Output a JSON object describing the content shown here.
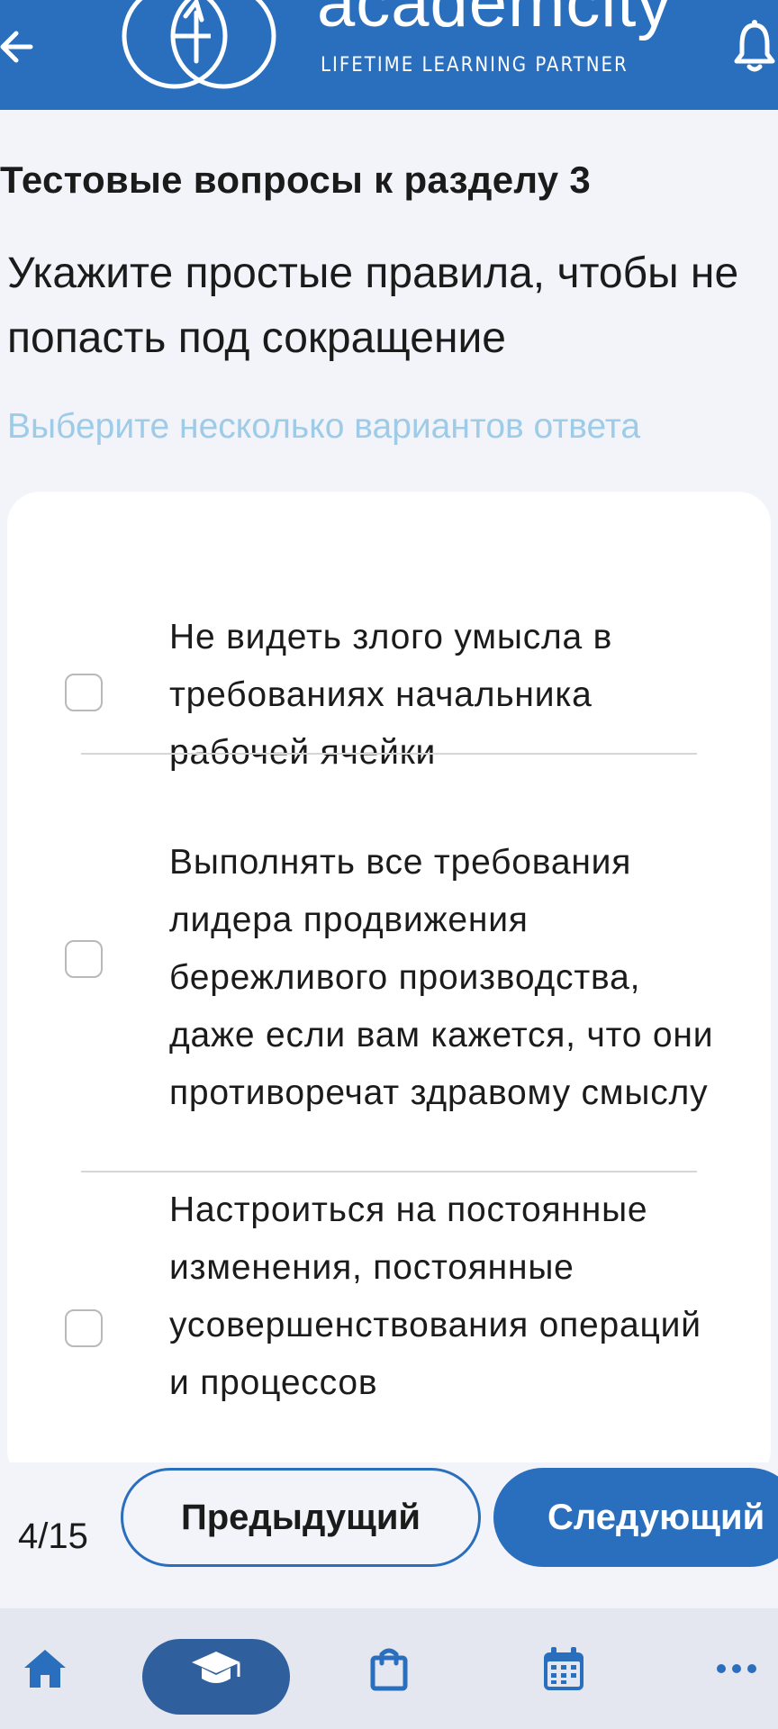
{
  "header": {
    "brand_name": "academcity",
    "brand_tagline": "LIFETIME LEARNING PARTNER",
    "colors": {
      "primary": "#2a6fbd",
      "text_on_primary": "#ffffff"
    }
  },
  "page": {
    "section_title": "Тестовые вопросы к разделу 3",
    "question": "Укажите простые правила, чтобы не попасть под сокращение",
    "hint": "Выберите несколько вариантов ответа"
  },
  "options": [
    {
      "text": "Не видеть злого умысла в требованиях начальника рабочей ячейки",
      "checked": false
    },
    {
      "text": "Выполнять все требования лидера продвижения бережливого производства, даже если вам кажется, что они противоречат здравому смыслу",
      "checked": false
    },
    {
      "text": "Настроиться на постоянные изменения, постоянные усовершенствования операций и процессов",
      "checked": false
    }
  ],
  "pager": {
    "counter": "4/15",
    "prev_label": "Предыдущий",
    "next_label": "Следующий"
  },
  "bottom_nav": {
    "items": [
      {
        "icon": "home-icon",
        "active": false
      },
      {
        "icon": "graduation-cap-icon",
        "active": true
      },
      {
        "icon": "shopping-bag-icon",
        "active": false
      },
      {
        "icon": "calendar-icon",
        "active": false
      },
      {
        "icon": "more-dots-icon",
        "active": false
      }
    ]
  }
}
